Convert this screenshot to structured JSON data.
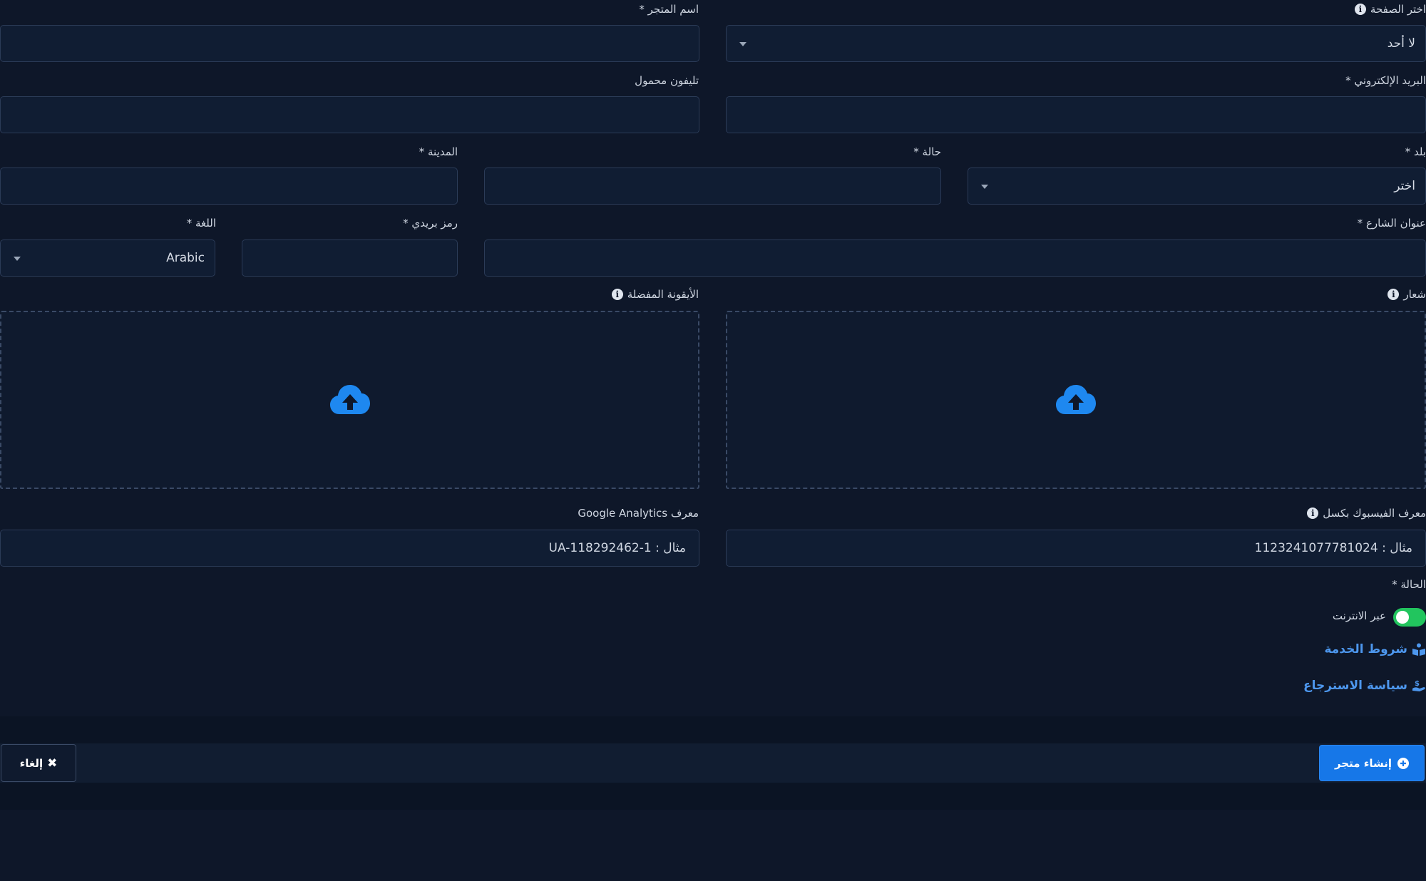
{
  "form": {
    "select_page": {
      "label": "اختر الصفحة",
      "value": "لا أحد"
    },
    "store_name": {
      "label": "اسم المتجر *",
      "placeholder": ""
    },
    "email": {
      "label": "البريد الإلكتروني *",
      "placeholder": ""
    },
    "mobile_phone": {
      "label": "تليفون محمول",
      "placeholder": ""
    },
    "country": {
      "label": "بلد *",
      "value": "اختر"
    },
    "state": {
      "label": "حالة *",
      "placeholder": ""
    },
    "city": {
      "label": "المدينة *",
      "placeholder": ""
    },
    "street_address": {
      "label": "عنوان الشارع *",
      "placeholder": ""
    },
    "postal_code": {
      "label": "رمز بريدي *",
      "placeholder": ""
    },
    "language": {
      "label": "اللغة *",
      "value": "Arabic"
    },
    "logo": {
      "label": "شعار",
      "icon": "cloud-upload-icon"
    },
    "favicon": {
      "label": "الأيقونة المفضلة",
      "icon": "cloud-upload-icon"
    },
    "facebook_pixel": {
      "label": "معرف الفيسبوك بكسل",
      "placeholder": "مثال : 1123241077781024"
    },
    "google_analytics": {
      "label": "معرف Google Analytics",
      "placeholder": "مثال : UA-118292462-1"
    },
    "status": {
      "label": "الحالة *",
      "toggle_label": "عبر الانترنت",
      "enabled": true
    }
  },
  "links": {
    "terms": "شروط الخدمة",
    "refund_policy": "سياسة الاسترجاع"
  },
  "footer": {
    "create_button": "إنشاء متجر",
    "cancel_button": "إلغاء"
  },
  "colors": {
    "background": "#0e1729",
    "input_bg": "#101d33",
    "border": "#2b3b57",
    "accent": "#1677e8",
    "link": "#4d97ee",
    "toggle_on": "#22c55e"
  }
}
